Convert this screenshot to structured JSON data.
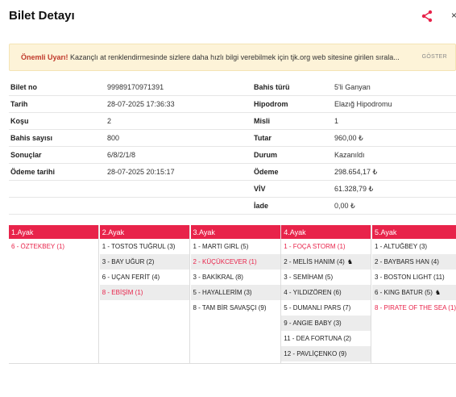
{
  "header": {
    "title": "Bilet Detayı",
    "share_icon": "share-icon",
    "close_icon": "close-icon"
  },
  "warning": {
    "title": "Önemli Uyarı!",
    "text": "Kazançlı at renklendirmesinde sizlere daha hızlı bilgi verebilmek için tjk.org web sitesine girilen sırala...",
    "button": "GÖSTER"
  },
  "details": [
    {
      "l1": "Bilet no",
      "v1": "99989170971391",
      "l2": "Bahis türü",
      "v2": "5'li Ganyan"
    },
    {
      "l1": "Tarih",
      "v1": "28-07-2025 17:36:33",
      "l2": "Hipodrom",
      "v2": "Elazığ Hipodromu"
    },
    {
      "l1": "Koşu",
      "v1": "2",
      "l2": "Misli",
      "v2": "1"
    },
    {
      "l1": "Bahis sayısı",
      "v1": "800",
      "l2": "Tutar",
      "v2": "960,00 ₺"
    },
    {
      "l1": "Sonuçlar",
      "v1": "6/8/2/1/8",
      "l2": "Durum",
      "v2": "Kazanıldı"
    },
    {
      "l1": "Ödeme tarihi",
      "v1": "28-07-2025 20:15:17",
      "l2": "Ödeme",
      "v2": "298.654,17 ₺"
    },
    {
      "l1": "",
      "v1": "",
      "l2": "VİV",
      "v2": "61.328,79 ₺"
    },
    {
      "l1": "",
      "v1": "",
      "l2": "İade",
      "v2": "0,00 ₺"
    }
  ],
  "legs": [
    {
      "title": "1.Ayak",
      "horses": [
        {
          "name": "6 - ÖZTEKBEY (1)",
          "winner": true,
          "icon": ""
        }
      ]
    },
    {
      "title": "2.Ayak",
      "horses": [
        {
          "name": "1 - TOSTOS TUĞRUL (3)",
          "winner": false,
          "icon": ""
        },
        {
          "name": "3 - BAY UĞUR (2)",
          "winner": false,
          "icon": ""
        },
        {
          "name": "6 - UÇAN FERİT (4)",
          "winner": false,
          "icon": ""
        },
        {
          "name": "8 - EBİŞİM (1)",
          "winner": true,
          "icon": ""
        }
      ]
    },
    {
      "title": "3.Ayak",
      "horses": [
        {
          "name": "1 - MARTI GIRL (5)",
          "winner": false,
          "icon": ""
        },
        {
          "name": "2 - KÜÇÜKCEVER (1)",
          "winner": true,
          "icon": ""
        },
        {
          "name": "3 - BAKİKRAL (8)",
          "winner": false,
          "icon": ""
        },
        {
          "name": "5 - HAYALLERİM (3)",
          "winner": false,
          "icon": ""
        },
        {
          "name": "8 - TAM BİR SAVAŞÇI (9)",
          "winner": false,
          "icon": ""
        }
      ]
    },
    {
      "title": "4.Ayak",
      "horses": [
        {
          "name": "1 - FOÇA STORM (1)",
          "winner": true,
          "icon": ""
        },
        {
          "name": "2 - MELİS HANIM (4)",
          "winner": false,
          "icon": "horse-icon"
        },
        {
          "name": "3 - SEMİHAM (5)",
          "winner": false,
          "icon": ""
        },
        {
          "name": "4 - YILDIZÖREN (6)",
          "winner": false,
          "icon": ""
        },
        {
          "name": "5 - DUMANLI PARS (7)",
          "winner": false,
          "icon": ""
        },
        {
          "name": "9 - ANGIE BABY (3)",
          "winner": false,
          "icon": ""
        },
        {
          "name": "11 - DEA FORTUNA (2)",
          "winner": false,
          "icon": ""
        },
        {
          "name": "12 - PAVLİÇENKO (9)",
          "winner": false,
          "icon": ""
        }
      ]
    },
    {
      "title": "5.Ayak",
      "horses": [
        {
          "name": "1 - ALTUĞBEY (3)",
          "winner": false,
          "icon": ""
        },
        {
          "name": "2 - BAYBARS HAN (4)",
          "winner": false,
          "icon": ""
        },
        {
          "name": "3 - BOSTON LIGHT (11)",
          "winner": false,
          "icon": ""
        },
        {
          "name": "6 - KING BATUR (5)",
          "winner": false,
          "icon": "horse-icon"
        },
        {
          "name": "8 - PIRATE OF THE SEA (1)",
          "winner": true,
          "icon": ""
        }
      ]
    }
  ],
  "colors": {
    "accent": "#e8234a",
    "warning_bg": "#fdf3d8",
    "alt_row": "#ececec"
  }
}
